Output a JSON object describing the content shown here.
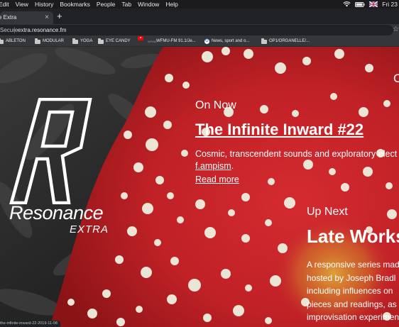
{
  "menubar": {
    "items": [
      "Edit",
      "View",
      "History",
      "Bookmarks",
      "People",
      "Tab",
      "Window",
      "Help"
    ],
    "clock": "Fri 23"
  },
  "browser": {
    "tab_title": "e Extra",
    "tab_close": "×",
    "new_tab": "+",
    "security": "Secure",
    "url": "extra.resonance.fm",
    "star": "☆",
    "bookmarks": [
      "ABLETON",
      "MODULAR",
      "YOGA",
      "EYE CANDY",
      "",
      "WFMU-FM 91.1/Je...",
      "News, sport and o...",
      "OP1/ORGANELLE/..."
    ],
    "wfmu_icon_text": "WFMU",
    "google_icon_text": "G",
    "status_url": "the-infinite-inward-22-2019-11-08"
  },
  "logo": {
    "word": "Resonance",
    "sub": "EXTRA"
  },
  "on_now": {
    "label": "On Now",
    "title": "The Infinite Inward #22",
    "desc_line1": "Cosmic, transcendent sounds and exploratory elect",
    "desc_link": "f.ampism",
    "desc_end": ".",
    "read_more": "Read more"
  },
  "up_next": {
    "label": "Up Next",
    "title": "Late Works",
    "desc": [
      "A responsive series mad",
      "hosted by Joseph Bradl",
      "including influences on",
      "pieces and readings, as",
      "improvisation experimen"
    ]
  },
  "corner": "C",
  "colors": {
    "mushroom_red": "#c8242c",
    "mushroom_dark": "#7a1012",
    "spot": "#ece4d4",
    "menubar": "#1b1b1d",
    "tab": "#35363a"
  }
}
